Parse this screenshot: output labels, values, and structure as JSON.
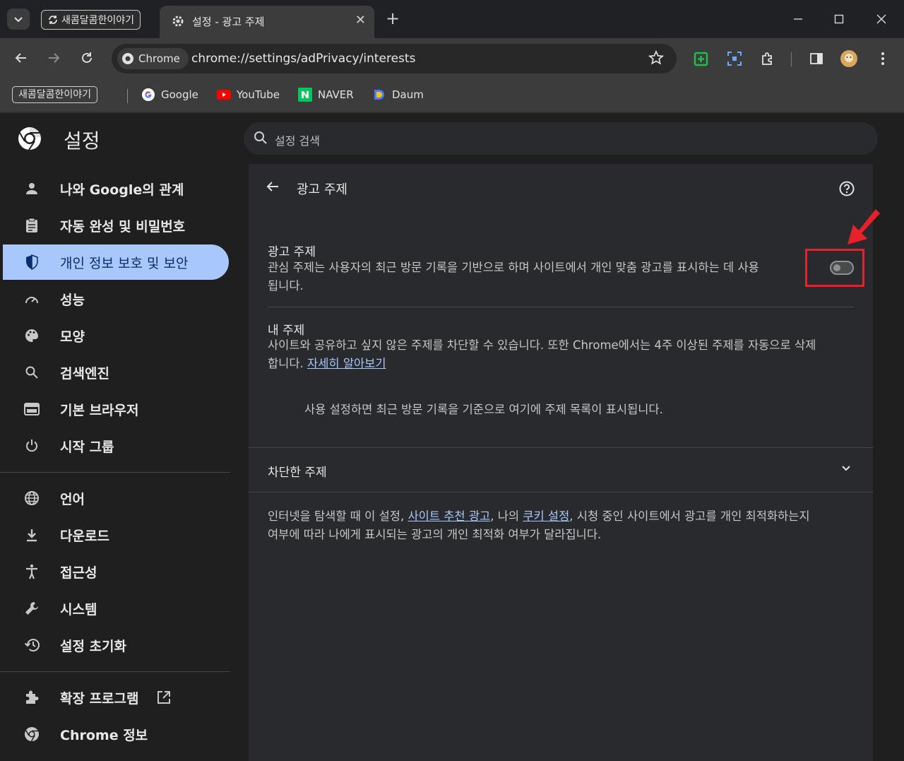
{
  "tabs": {
    "group_label": "새콤달콤한이야기",
    "active_title": "설정 - 광고 주제",
    "close_symbol": "✕",
    "new_tab_symbol": "+"
  },
  "window": {
    "minimize": "—",
    "maximize": "☐",
    "close": "✕"
  },
  "toolbar": {
    "chip_label": "Chrome",
    "url": "chrome://settings/adPrivacy/interests"
  },
  "bookmarks": [
    {
      "label": "새콤달콤한이야기"
    },
    {
      "label": "Google"
    },
    {
      "label": "YouTube"
    },
    {
      "label": "NAVER"
    },
    {
      "label": "Daum"
    }
  ],
  "header": {
    "title": "설정",
    "search_placeholder": "설정 검색"
  },
  "sidebar": {
    "items": [
      {
        "label": "나와 Google의 관계",
        "icon": "person-icon"
      },
      {
        "label": "자동 완성 및 비밀번호",
        "icon": "clipboard-icon"
      },
      {
        "label": "개인 정보 보호 및 보안",
        "icon": "shield-icon",
        "active": true
      },
      {
        "label": "성능",
        "icon": "speedometer-icon"
      },
      {
        "label": "모양",
        "icon": "palette-icon"
      },
      {
        "label": "검색엔진",
        "icon": "search-icon"
      },
      {
        "label": "기본 브라우저",
        "icon": "browser-icon"
      },
      {
        "label": "시작 그룹",
        "icon": "power-icon"
      },
      {
        "label": "언어",
        "icon": "globe-icon"
      },
      {
        "label": "다운로드",
        "icon": "download-icon"
      },
      {
        "label": "접근성",
        "icon": "accessibility-icon"
      },
      {
        "label": "시스템",
        "icon": "wrench-icon"
      },
      {
        "label": "설정 초기화",
        "icon": "reset-icon"
      },
      {
        "label": "확장 프로그램",
        "icon": "puzzle-icon"
      },
      {
        "label": "Chrome 정보",
        "icon": "chrome-icon"
      }
    ]
  },
  "main": {
    "heading": "광고 주제",
    "ad_topics": {
      "title": "광고 주제",
      "desc_line1": "관심 주제는 사용자의 최근 방문 기록을 기반으로 하며 사이트에서 개인 맞춤 광고를 표시하는 데 사용",
      "desc_line2": "됩니다.",
      "toggle_on": false
    },
    "my_topics": {
      "title": "내 주제",
      "desc_line1": "사이트와 공유하고 싶지 않은 주제를 차단할 수 있습니다. 또한 Chrome에서는 4주 이상된 주제를 자동으로 삭제",
      "desc_line2_prefix": "합니다. ",
      "learn_more": "자세히 알아보기"
    },
    "empty_message": "사용 설정하면 최근 방문 기록을 기준으로 여기에 주제 목록이 표시됩니다.",
    "blocked_topics": "차단한 주제",
    "footer": {
      "part1": "인터넷을 탐색할 때 이 설정, ",
      "link1": "사이트 추천 광고",
      "part2": ", 나의 ",
      "link2": "쿠키 설정",
      "part3": ", 시청 중인 사이트에서 광고를 개인 최적화하는지",
      "line2": "여부에 따라 나에게 표시되는 광고의 개인 최적화 여부가 달라집니다."
    }
  },
  "colors": {
    "accent": "#a8c7fa",
    "highlight": "#e8202a"
  }
}
